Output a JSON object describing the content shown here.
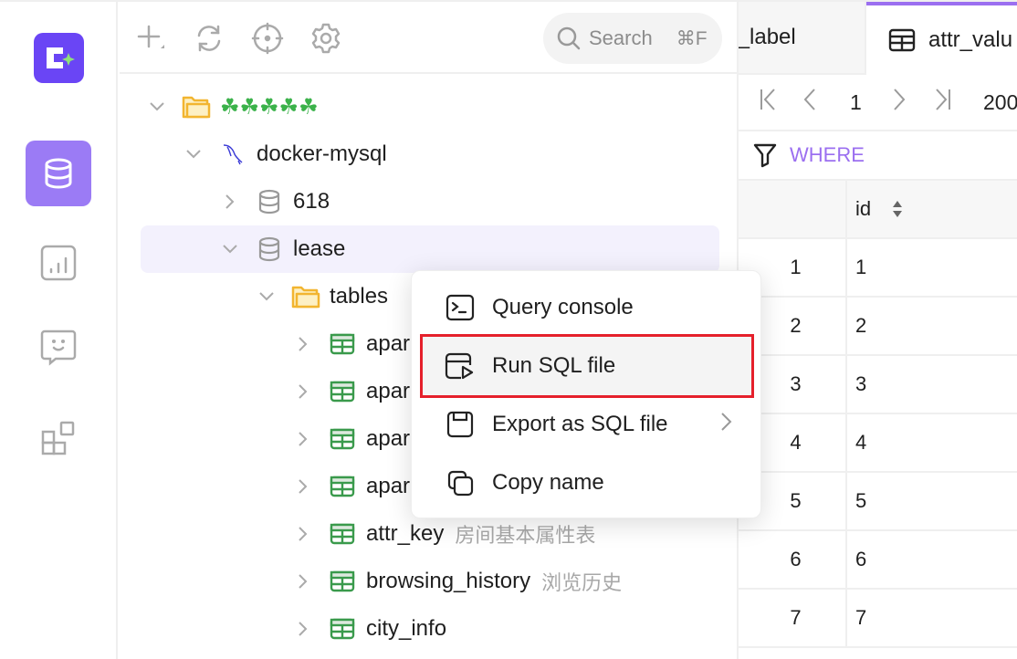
{
  "rail": {
    "logo": "app-logo",
    "items": [
      {
        "name": "databases",
        "icon": "database-icon",
        "active": true
      },
      {
        "name": "dashboard",
        "icon": "bar-chart-icon",
        "active": false
      },
      {
        "name": "ai-chat",
        "icon": "chat-smile-icon",
        "active": false
      },
      {
        "name": "extensions",
        "icon": "blocks-icon",
        "active": false
      }
    ]
  },
  "toolbar": {
    "search_placeholder": "Search",
    "search_shortcut": "⌘F"
  },
  "tree": {
    "group": {
      "label": "☘☘☘☘☘",
      "icon": "folder-icon",
      "expanded": true
    },
    "connection": {
      "label": "docker-mysql",
      "icon": "mysql-dolphin-icon",
      "expanded": true
    },
    "databases": [
      {
        "label": "618",
        "expanded": false
      },
      {
        "label": "lease",
        "expanded": true,
        "selected": true
      }
    ],
    "tables_folder": {
      "label": "tables",
      "expanded": true
    },
    "tables": [
      {
        "label": "apar",
        "desc": ""
      },
      {
        "label": "apar",
        "desc": ""
      },
      {
        "label": "apar",
        "desc": ""
      },
      {
        "label": "apar",
        "desc": ""
      },
      {
        "label": "attr_key",
        "desc": "房间基本属性表"
      },
      {
        "label": "browsing_history",
        "desc": "浏览历史"
      },
      {
        "label": "city_info",
        "desc": ""
      }
    ]
  },
  "context_menu": {
    "items": [
      {
        "label": "Query console",
        "icon": "terminal-icon",
        "highlighted": false,
        "submenu": false
      },
      {
        "label": "Run SQL file",
        "icon": "run-file-icon",
        "highlighted": true,
        "submenu": false
      },
      {
        "label": "Export as SQL file",
        "icon": "save-icon",
        "highlighted": false,
        "submenu": true
      },
      {
        "label": "Copy name",
        "icon": "copy-icon",
        "highlighted": false,
        "submenu": false
      }
    ]
  },
  "data_panel": {
    "tabs": [
      {
        "label": "t_label",
        "active": false
      },
      {
        "label": "attr_valu",
        "active": true
      }
    ],
    "pager": {
      "page": "1",
      "page_size": "200"
    },
    "where_label": "WHERE",
    "column_header": "id",
    "rows": [
      {
        "row": "1",
        "id": "1"
      },
      {
        "row": "2",
        "id": "2"
      },
      {
        "row": "3",
        "id": "3"
      },
      {
        "row": "4",
        "id": "4"
      },
      {
        "row": "5",
        "id": "5"
      },
      {
        "row": "6",
        "id": "6"
      },
      {
        "row": "7",
        "id": "7"
      }
    ]
  },
  "colors": {
    "accent": "#9b6ff0",
    "logo": "#6a45f5",
    "highlight_outline": "#e5202b",
    "table_icon": "#3a9a4c",
    "folder_icon": "#f2b530"
  }
}
